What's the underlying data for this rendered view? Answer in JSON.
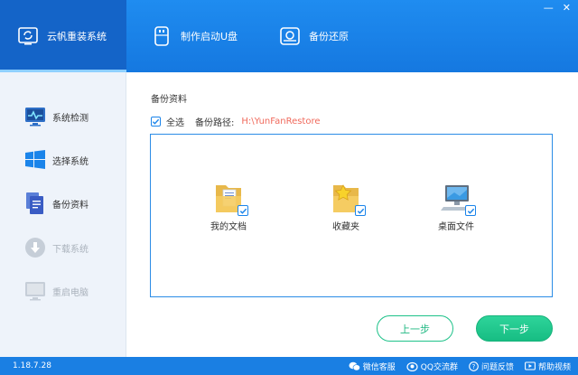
{
  "window": {
    "min_label": "—",
    "close_label": "✕"
  },
  "tabs": [
    {
      "label": "云帆重装系统",
      "icon": "reinstall-icon",
      "active": true
    },
    {
      "label": "制作启动U盘",
      "icon": "usb-icon",
      "active": false
    },
    {
      "label": "备份还原",
      "icon": "backup-restore-icon",
      "active": false
    }
  ],
  "sidebar": {
    "items": [
      {
        "label": "系统检测",
        "icon": "monitor-pulse-icon",
        "enabled": true
      },
      {
        "label": "选择系统",
        "icon": "windows-logo-icon",
        "enabled": true
      },
      {
        "label": "备份资料",
        "icon": "documents-icon",
        "enabled": true
      },
      {
        "label": "下载系统",
        "icon": "download-icon",
        "enabled": false
      },
      {
        "label": "重启电脑",
        "icon": "restart-computer-icon",
        "enabled": false
      }
    ]
  },
  "main": {
    "title": "备份资料",
    "select_all_label": "全选",
    "path_label": "备份路径:",
    "path_value": "H:\\YunFanRestore",
    "items": [
      {
        "label": "我的文档",
        "icon": "my-documents-folder-icon",
        "checked": true
      },
      {
        "label": "收藏夹",
        "icon": "favorites-folder-icon",
        "checked": true
      },
      {
        "label": "桌面文件",
        "icon": "desktop-computer-icon",
        "checked": true
      }
    ],
    "prev_label": "上一步",
    "next_label": "下一步"
  },
  "status": {
    "version": "1.18.7.28",
    "links": [
      {
        "label": "微信客服",
        "icon": "wechat-icon"
      },
      {
        "label": "QQ交流群",
        "icon": "qq-icon"
      },
      {
        "label": "问题反馈",
        "icon": "feedback-icon"
      },
      {
        "label": "帮助视频",
        "icon": "help-video-icon"
      }
    ]
  },
  "colors": {
    "header": "#1f8cf0",
    "accent_green": "#1fc28a",
    "path_red": "#f06a5c",
    "status_bar": "#1a7fe3"
  }
}
